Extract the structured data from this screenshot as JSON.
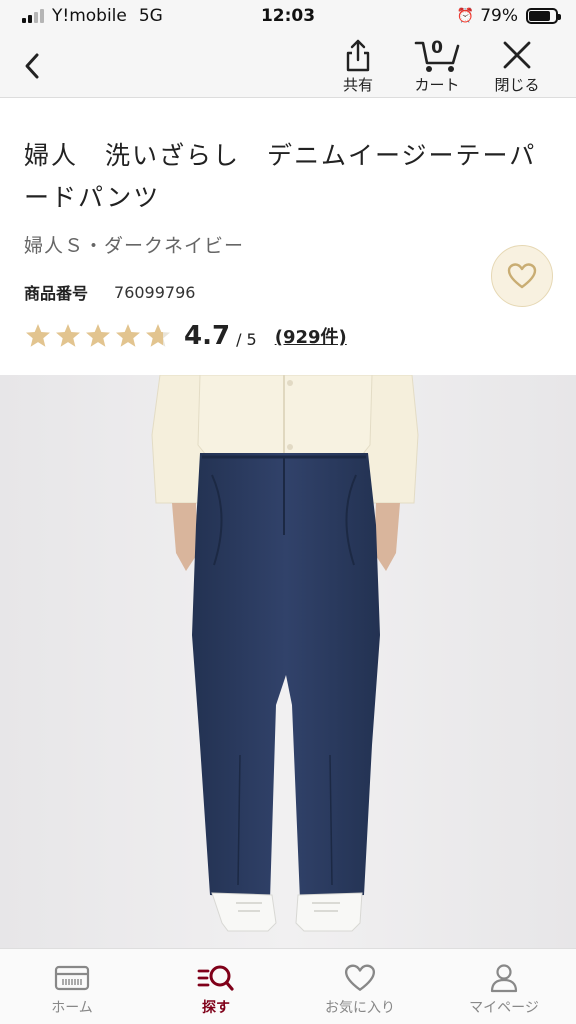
{
  "status_bar": {
    "carrier": "Y!mobile",
    "network": "5G",
    "time": "12:03",
    "battery_percent": "79%",
    "battery_level": 0.79
  },
  "nav": {
    "back_icon": "chevron-left-icon",
    "share_label": "共有",
    "cart_label": "カート",
    "cart_count": "0",
    "close_label": "閉じる"
  },
  "product": {
    "title": "婦人　洗いざらし　デニムイージーテーパードパンツ",
    "variant": "婦人Ｓ・ダークネイビー",
    "code_label": "商品番号",
    "code_value": "76099796",
    "rating_value": "4.7",
    "rating_max": "/ 5",
    "rating_numeric": 4.7,
    "review_count": "(929件)"
  },
  "tabs": [
    {
      "label": "ホーム",
      "icon": "home-card-icon",
      "active": false
    },
    {
      "label": "探す",
      "icon": "search-icon",
      "active": true
    },
    {
      "label": "お気に入り",
      "icon": "heart-icon",
      "active": false
    },
    {
      "label": "マイページ",
      "icon": "user-icon",
      "active": false
    }
  ],
  "colors": {
    "accent": "#7f0019",
    "star": "#e2c48f",
    "fav_bg": "#f8f1e0",
    "denim": "#2b3a5a",
    "jacket": "#f5efdc"
  }
}
